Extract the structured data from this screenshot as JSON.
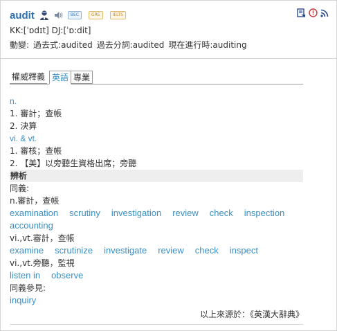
{
  "entry": {
    "word": "audit",
    "badges": [
      "BEC",
      "GRE",
      "IELTS"
    ],
    "phonetic": "KK:[ˈɒdɪt] DJ:[ˈɒ:dit]",
    "forms_label": "動變:",
    "forms": [
      "過去式:audited",
      "過去分詞:audited",
      "現在進行時:auditing"
    ]
  },
  "icons": {
    "person": "person-icon",
    "speaker": "speaker-icon",
    "bookmark": "bookmark-icon",
    "alert": "alert-icon",
    "rss": "rss-icon"
  },
  "tabs": [
    "權威釋義",
    "英語",
    "專業"
  ],
  "definitions": {
    "pos_n": "n.",
    "n_1": "1. 審計；查帳",
    "n_2": "2. 決算",
    "pos_v": "vi. & vt.",
    "v_1": "1. 審核；查帳",
    "v_2": "2. 【美】以旁聽生資格出席；旁聽"
  },
  "analysis": {
    "title": "辨析",
    "synonyms_label": "同義:",
    "n_label": "n.審計，查帳",
    "n_words": [
      "examination",
      "scrutiny",
      "investigation",
      "review",
      "check",
      "inspection"
    ],
    "n_words_2": [
      "accounting"
    ],
    "v1_label": "vi.,vt.審計，查帳",
    "v1_words": [
      "examine",
      "scrutinize",
      "investigate",
      "review",
      "check",
      "inspect"
    ],
    "v2_label": "vi.,vt.旁聽，監視",
    "v2_words": [
      "listen in",
      "observe"
    ],
    "see_also_label": "同義參見:",
    "see_also": [
      "inquiry"
    ]
  },
  "source": "以上來源於：《英漢大辭典》",
  "colors": {
    "accent": "#3a8fc4",
    "word": "#2a6fb0",
    "section_bg": "#eeeeee"
  }
}
